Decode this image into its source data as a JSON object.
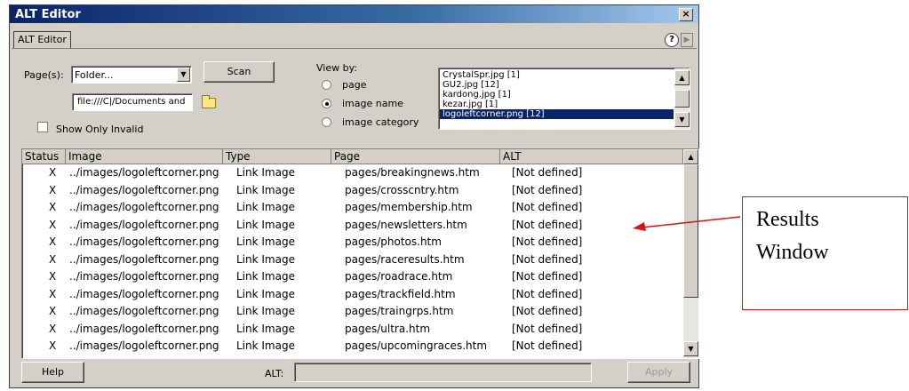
{
  "window": {
    "title": "ALT Editor",
    "close_glyph": "×"
  },
  "tab": {
    "label": "ALT Editor",
    "help_glyph": "?",
    "more_glyph": "▶"
  },
  "form": {
    "pages_label": "Page(s):",
    "pages_value": "Folder...",
    "path_value": "file:///C|/Documents and",
    "scan_label": "Scan",
    "show_invalid_label": "Show Only Invalid",
    "view_by_label": "View by:",
    "view_options": [
      "page",
      "image name",
      "image category"
    ],
    "view_selected": "image name"
  },
  "image_list": [
    "CrystalSpr.jpg [1]",
    "GU2.jpg [12]",
    "kardong.jpg [1]",
    "kezar.jpg [1]",
    "logoleftcorner.png [12]"
  ],
  "image_list_selected": 4,
  "results": {
    "columns": [
      "Status",
      "Image",
      "Type",
      "Page",
      "ALT"
    ],
    "rows": [
      [
        "X",
        "../images/logoleftcorner.png",
        "Link Image",
        "pages/breakingnews.htm",
        "[Not defined]"
      ],
      [
        "X",
        "../images/logoleftcorner.png",
        "Link Image",
        "pages/crosscntry.htm",
        "[Not defined]"
      ],
      [
        "X",
        "../images/logoleftcorner.png",
        "Link Image",
        "pages/membership.htm",
        "[Not defined]"
      ],
      [
        "X",
        "../images/logoleftcorner.png",
        "Link Image",
        "pages/newsletters.htm",
        "[Not defined]"
      ],
      [
        "X",
        "../images/logoleftcorner.png",
        "Link Image",
        "pages/photos.htm",
        "[Not defined]"
      ],
      [
        "X",
        "../images/logoleftcorner.png",
        "Link Image",
        "pages/raceresults.htm",
        "[Not defined]"
      ],
      [
        "X",
        "../images/logoleftcorner.png",
        "Link Image",
        "pages/roadrace.htm",
        "[Not defined]"
      ],
      [
        "X",
        "../images/logoleftcorner.png",
        "Link Image",
        "pages/trackfield.htm",
        "[Not defined]"
      ],
      [
        "X",
        "../images/logoleftcorner.png",
        "Link Image",
        "pages/traingrps.htm",
        "[Not defined]"
      ],
      [
        "X",
        "../images/logoleftcorner.png",
        "Link Image",
        "pages/ultra.htm",
        "[Not defined]"
      ],
      [
        "X",
        "../images/logoleftcorner.png",
        "Link Image",
        "pages/upcomingraces.htm",
        "[Not defined]"
      ]
    ]
  },
  "footer": {
    "help_label": "Help",
    "alt_label": "ALT:",
    "alt_value": "",
    "apply_label": "Apply"
  },
  "annotation": {
    "line1": "Results",
    "line2": "Window"
  },
  "colors": {
    "titlebar": "#0a246a",
    "selection": "#0a246a",
    "callout_border": "#dd1111",
    "arrow": "#dd1111"
  }
}
